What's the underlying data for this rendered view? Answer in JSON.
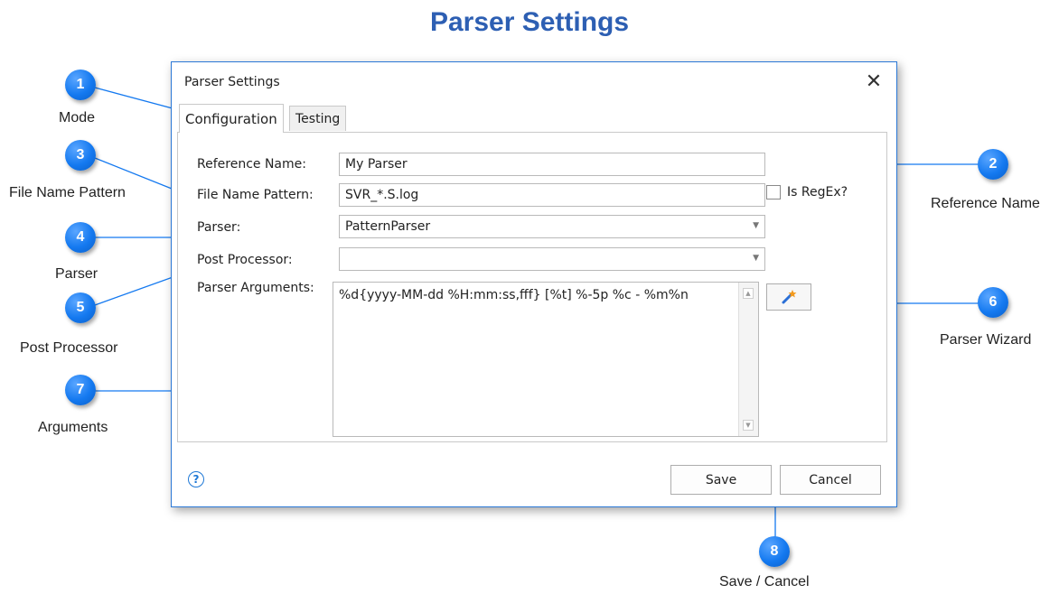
{
  "page_title": "Parser Settings",
  "dialog": {
    "title": "Parser Settings",
    "close_glyph": "✕",
    "tabs": [
      {
        "label": "Configuration",
        "active": true
      },
      {
        "label": "Testing",
        "active": false
      }
    ],
    "fields": {
      "reference_name": {
        "label": "Reference Name:",
        "value": "My Parser"
      },
      "file_name_pattern": {
        "label": "File Name Pattern:",
        "value": "SVR_*.S.log"
      },
      "is_regex": {
        "label": "Is RegEx?",
        "checked": false
      },
      "parser": {
        "label": "Parser:",
        "value": "PatternParser"
      },
      "post_processor": {
        "label": "Post Processor:",
        "value": ""
      },
      "parser_arguments": {
        "label": "Parser Arguments:",
        "value": "%d{yyyy-MM-dd %H:mm:ss,fff} [%t] %-5p %c - %m%n"
      }
    },
    "buttons": {
      "save": "Save",
      "cancel": "Cancel",
      "help_glyph": "?"
    }
  },
  "callouts": [
    {
      "number": "1",
      "label": "Mode"
    },
    {
      "number": "2",
      "label": "Reference Name"
    },
    {
      "number": "3",
      "label": "File Name Pattern"
    },
    {
      "number": "4",
      "label": "Parser"
    },
    {
      "number": "5",
      "label": "Post Processor"
    },
    {
      "number": "6",
      "label": "Parser Wizard"
    },
    {
      "number": "7",
      "label": "Arguments"
    },
    {
      "number": "8",
      "label": "Save / Cancel"
    }
  ],
  "colors": {
    "title": "#2d5fb3",
    "badge": "#1479f0",
    "dialog_border": "#2b78d6",
    "callout_line": "#1479f0"
  },
  "icons": {
    "wizard": "magic-wand-icon",
    "help": "help-circle-icon",
    "close": "close-icon",
    "dropdown": "chevron-down-icon"
  }
}
